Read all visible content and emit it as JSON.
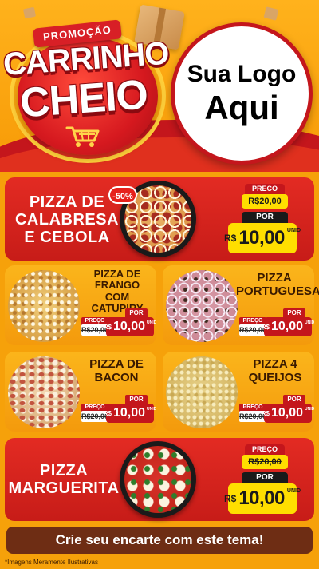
{
  "header": {
    "promo_label": "PROMOÇÃO",
    "title_line1": "CARRINHO",
    "title_line2": "CHEIO",
    "logo_line1": "Sua Logo",
    "logo_line2": "Aqui"
  },
  "colors": {
    "brand_red": "#c4161c",
    "brand_orange": "#f79a06",
    "price_yellow": "#ffde00",
    "footer_brown": "#6e2d14"
  },
  "featured": [
    {
      "name_line1": "PIZZA DE",
      "name_line2": "CALABRESA",
      "name_line3": "E CEBOLA",
      "discount": "-50%",
      "preco_label": "PRECO",
      "old_price": "R$20,00",
      "por_label": "POR",
      "currency": "R$",
      "new_price": "10,00",
      "unit": "UNID"
    },
    {
      "name_line1": "PIZZA",
      "name_line2": "MARGUERITA",
      "preco_label": "PREÇO",
      "old_price": "R$20,00",
      "por_label": "POR",
      "currency": "R$",
      "new_price": "10,00",
      "unit": "UNID"
    }
  ],
  "grid": [
    {
      "name_line1": "PIZZA DE",
      "name_line2": "FRANGO COM",
      "name_line3": "CATUPIRY",
      "preco_label": "PREÇO",
      "old_price": "R$20,00",
      "por_label": "POR",
      "currency": "R$",
      "new_price": "10,00",
      "unit": "UNID"
    },
    {
      "name_line1": "PIZZA",
      "name_line2": "PORTUGUESA",
      "preco_label": "PREÇO",
      "old_price": "R$20,00",
      "por_label": "POR",
      "currency": "R$",
      "new_price": "10,00",
      "unit": "UNID"
    },
    {
      "name_line1": "PIZZA DE",
      "name_line2": "BACON",
      "preco_label": "PREÇO",
      "old_price": "R$20,00",
      "por_label": "POR",
      "currency": "R$",
      "new_price": "10,00",
      "unit": "UNID"
    },
    {
      "name_line1": "PIZZA 4",
      "name_line2": "QUEIJOS",
      "preco_label": "PREÇO",
      "old_price": "R$20,00",
      "por_label": "POR",
      "currency": "R$",
      "new_price": "10,00",
      "unit": "UNID"
    }
  ],
  "footer": {
    "cta": "Crie seu encarte com este tema!",
    "disclaimer": "*Imagens Meramente Ilustrativas"
  },
  "icons": [
    "shopping-cart-icon",
    "box-icon"
  ]
}
